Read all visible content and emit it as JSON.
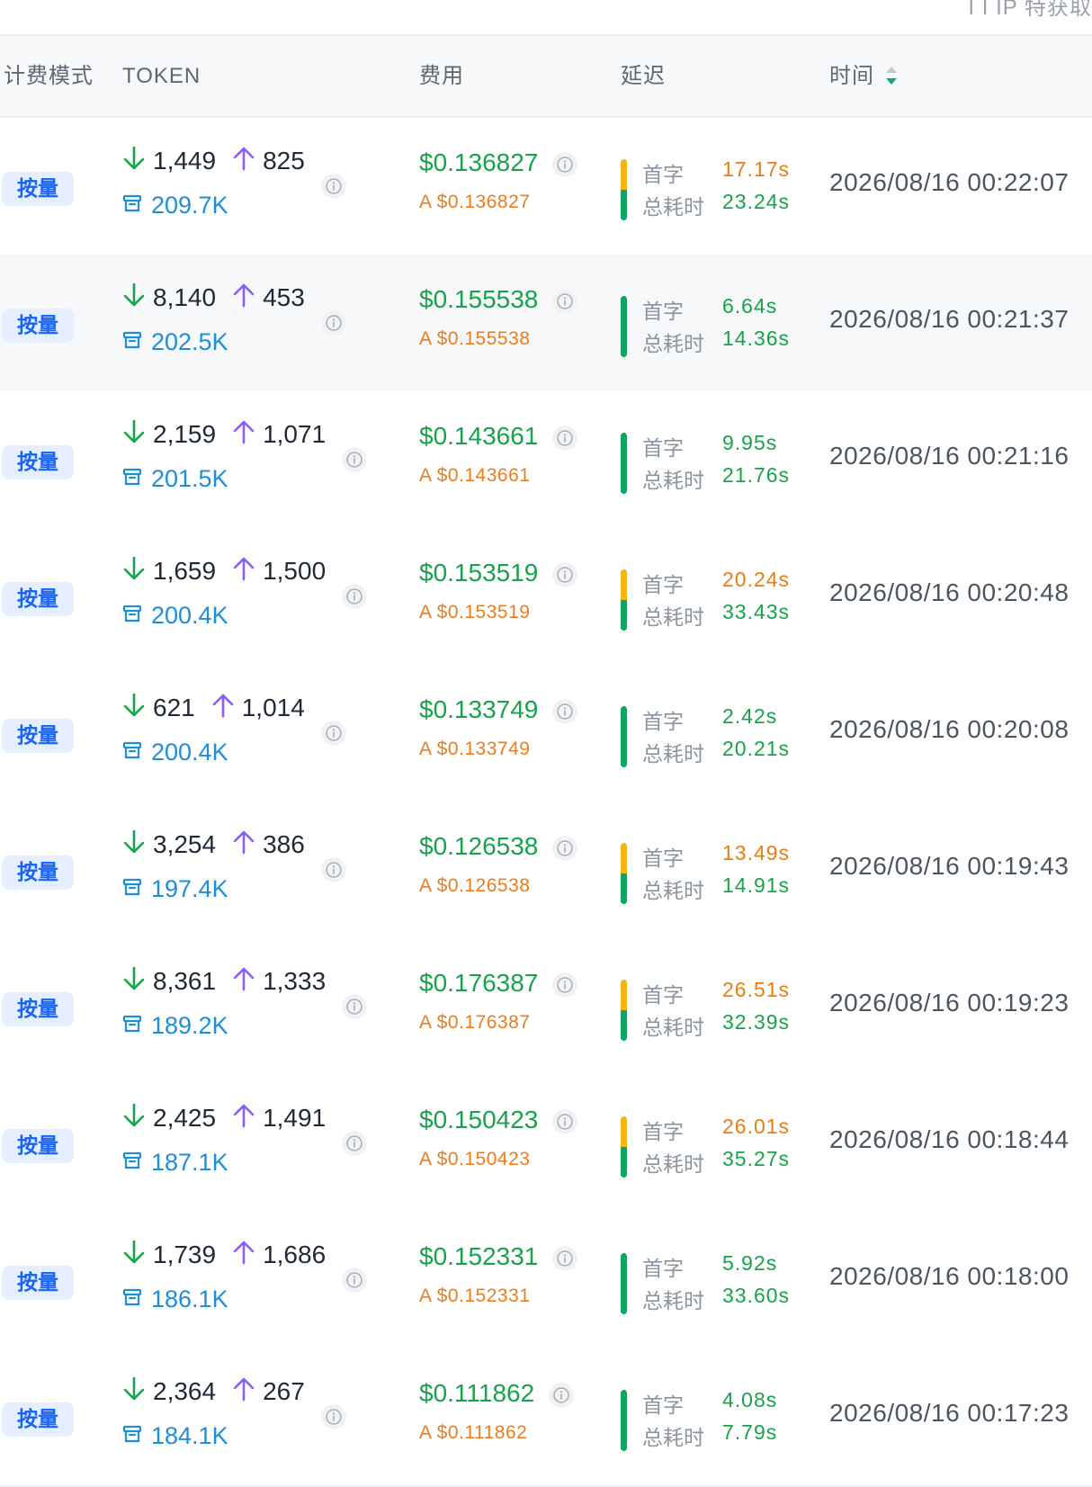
{
  "topbar": {
    "clipped_text": "I I IP 特获取"
  },
  "columns": {
    "billing_mode": "计费模式",
    "token": "TOKEN",
    "cost": "费用",
    "latency": "延迟",
    "time": "时间"
  },
  "colors": {
    "input_arrow": "#16a34a",
    "output_arrow": "#8b5cf6",
    "cache": "#1d8fd8",
    "price": "#17a34a",
    "sub_price": "#ef7c1b",
    "latency_slow": "#f5b316",
    "latency_ok": "#12a362"
  },
  "labels": {
    "first_token": "首字",
    "total_time": "总耗时"
  },
  "rows": [
    {
      "mode": "按量",
      "input": "1,449",
      "output": "825",
      "cache": "209.7K",
      "price": "$0.136827",
      "sub_price": "A $0.136827",
      "first": "17.17s",
      "first_status": "slow",
      "total": "23.24s",
      "time": "2026/08/16 00:22:07"
    },
    {
      "mode": "按量",
      "input": "8,140",
      "output": "453",
      "cache": "202.5K",
      "price": "$0.155538",
      "sub_price": "A $0.155538",
      "first": "6.64s",
      "first_status": "ok",
      "total": "14.36s",
      "time": "2026/08/16 00:21:37"
    },
    {
      "mode": "按量",
      "input": "2,159",
      "output": "1,071",
      "cache": "201.5K",
      "price": "$0.143661",
      "sub_price": "A $0.143661",
      "first": "9.95s",
      "first_status": "ok",
      "total": "21.76s",
      "time": "2026/08/16 00:21:16"
    },
    {
      "mode": "按量",
      "input": "1,659",
      "output": "1,500",
      "cache": "200.4K",
      "price": "$0.153519",
      "sub_price": "A $0.153519",
      "first": "20.24s",
      "first_status": "slow",
      "total": "33.43s",
      "time": "2026/08/16 00:20:48"
    },
    {
      "mode": "按量",
      "input": "621",
      "output": "1,014",
      "cache": "200.4K",
      "price": "$0.133749",
      "sub_price": "A $0.133749",
      "first": "2.42s",
      "first_status": "ok",
      "total": "20.21s",
      "time": "2026/08/16 00:20:08"
    },
    {
      "mode": "按量",
      "input": "3,254",
      "output": "386",
      "cache": "197.4K",
      "price": "$0.126538",
      "sub_price": "A $0.126538",
      "first": "13.49s",
      "first_status": "slow",
      "total": "14.91s",
      "time": "2026/08/16 00:19:43"
    },
    {
      "mode": "按量",
      "input": "8,361",
      "output": "1,333",
      "cache": "189.2K",
      "price": "$0.176387",
      "sub_price": "A $0.176387",
      "first": "26.51s",
      "first_status": "slow",
      "total": "32.39s",
      "time": "2026/08/16 00:19:23"
    },
    {
      "mode": "按量",
      "input": "2,425",
      "output": "1,491",
      "cache": "187.1K",
      "price": "$0.150423",
      "sub_price": "A $0.150423",
      "first": "26.01s",
      "first_status": "slow",
      "total": "35.27s",
      "time": "2026/08/16 00:18:44"
    },
    {
      "mode": "按量",
      "input": "1,739",
      "output": "1,686",
      "cache": "186.1K",
      "price": "$0.152331",
      "sub_price": "A $0.152331",
      "first": "5.92s",
      "first_status": "ok",
      "total": "33.60s",
      "time": "2026/08/16 00:18:00"
    },
    {
      "mode": "按量",
      "input": "2,364",
      "output": "267",
      "cache": "184.1K",
      "price": "$0.111862",
      "sub_price": "A $0.111862",
      "first": "4.08s",
      "first_status": "ok",
      "total": "7.79s",
      "time": "2026/08/16 00:17:23"
    }
  ]
}
